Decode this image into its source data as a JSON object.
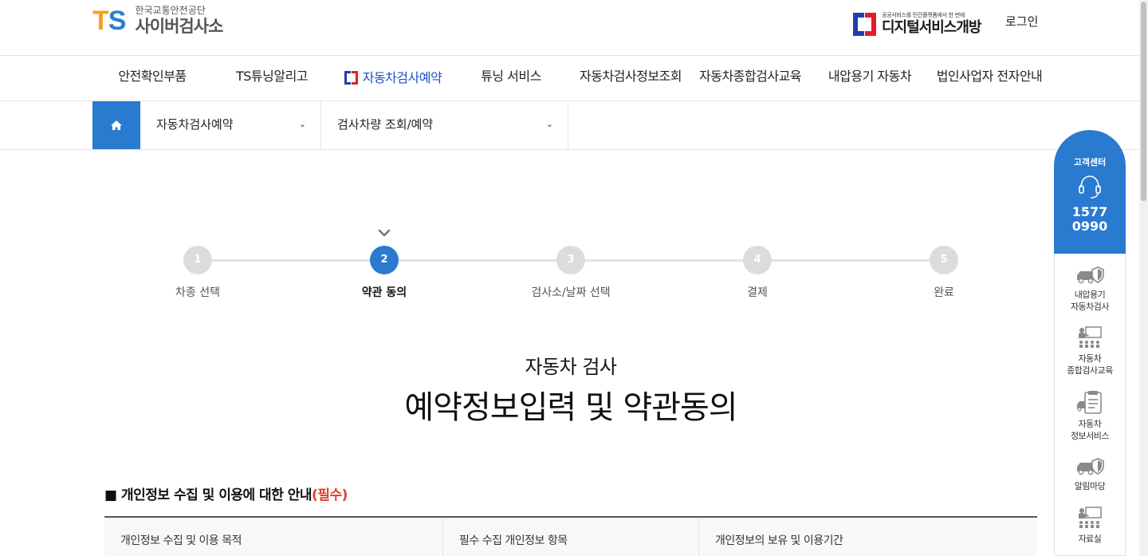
{
  "header": {
    "logo_mark_t": "T",
    "logo_mark_s": "S",
    "org_name": "한국교통안전공단",
    "site_name": "사이버검사소",
    "digital_banner_sub": "공공서비스를 민간플랫폼에서 한 번에",
    "digital_banner_main": "디지털서비스개방",
    "login_label": "로그인"
  },
  "gnb": {
    "items": [
      {
        "label": "안전확인부품"
      },
      {
        "label": "TS튜닝알리고"
      },
      {
        "label": "자동차검사예약",
        "active": true
      },
      {
        "label": "튜닝 서비스"
      },
      {
        "label": "자동차검사정보조회"
      },
      {
        "label": "자동차종합검사교육"
      },
      {
        "label": "내압용기 자동차"
      },
      {
        "label": "법인사업자 전자안내"
      }
    ]
  },
  "breadcrumb": {
    "home_icon": "home-icon",
    "level1": "자동차검사예약",
    "level2": "검사차량 조회/예약"
  },
  "steps": {
    "current": 2,
    "items": [
      {
        "num": "1",
        "label": "차종 선택"
      },
      {
        "num": "2",
        "label": "약관 동의"
      },
      {
        "num": "3",
        "label": "검사소/날짜 선택"
      },
      {
        "num": "4",
        "label": "결제"
      },
      {
        "num": "5",
        "label": "완료"
      }
    ]
  },
  "title": {
    "sub": "자동차 검사",
    "main": "예약정보입력 및 약관동의"
  },
  "section": {
    "bullet": "■",
    "heading": "개인정보 수집 및 이용에 대한 안내",
    "required": "(필수)",
    "columns": [
      "개인정보 수집 및 이용 목적",
      "필수 수집 개인정보 항목",
      "개인정보의 보유 및 이용기간"
    ]
  },
  "quick_menu": {
    "cs_label": "고객센터",
    "cs_phone_1": "1577",
    "cs_phone_2": "0990",
    "items": [
      {
        "line1": "내압용기",
        "line2": "자동차검사",
        "icon": "car-shield-icon"
      },
      {
        "line1": "자동차",
        "line2": "종합검사교육",
        "icon": "classroom-icon"
      },
      {
        "line1": "자동차",
        "line2": "정보서비스",
        "icon": "document-icon"
      },
      {
        "line1": "알림마당",
        "line2": "",
        "icon": "car-shield-icon"
      },
      {
        "line1": "자료실",
        "line2": "",
        "icon": "classroom-icon"
      }
    ]
  },
  "colors": {
    "primary_blue": "#2a7ad0",
    "nav_active": "#1f4fc8",
    "required_red": "#e2402a",
    "step_inactive": "#dcdcdc"
  }
}
